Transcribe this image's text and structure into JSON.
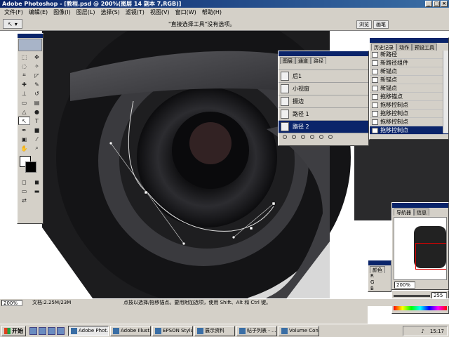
{
  "window": {
    "title": "Adobe Photoshop - [教程.psd @ 200%(图层 14 副本 7,RGB)]"
  },
  "menu": [
    "文件(F)",
    "编辑(E)",
    "图像(I)",
    "图层(L)",
    "选择(S)",
    "滤镜(T)",
    "视图(V)",
    "窗口(W)",
    "帮助(H)"
  ],
  "options_bar": {
    "message": "\"直接选择工具\"没有选项。",
    "tabs": [
      "浏览",
      "画笔"
    ]
  },
  "paths_panel": {
    "tabs": [
      "图层",
      "通道",
      "路径"
    ],
    "rows": [
      "",
      "后1",
      "小视窗",
      "摄边",
      "路径 1",
      "路径 2"
    ]
  },
  "history_panel": {
    "tabs": [
      "历史记录",
      "动作",
      "预设工具"
    ],
    "rows": [
      "新路径",
      "新路径组件",
      "新锚点",
      "新锚点",
      "新锚点",
      "拖移锚点",
      "拖移控制点",
      "拖移控制点",
      "拖移控制点",
      "拖移控制点"
    ]
  },
  "navigator_panel": {
    "tabs": [
      "导航器",
      "信息"
    ],
    "zoom": "200%"
  },
  "color_panel": {
    "tabs": [
      "颜色"
    ],
    "channels": [
      "R",
      "G",
      "B"
    ],
    "b_value": "255"
  },
  "status_bar": {
    "zoom": "200%",
    "doc_size": "文档:2.25M/23M",
    "hint": "点按以选择/拖移锚点。要用附加选项，使用 Shift、Alt 和 Ctrl 键。"
  },
  "taskbar": {
    "start": "开始",
    "tasks": [
      "Adobe Phot...",
      "Adobe Illust...",
      "EPSON Stylu...",
      "展示资料",
      "帖子列表 - ...",
      "Volume Control"
    ],
    "clock": "15:17"
  },
  "colors": {
    "titlebar": "#0a246a",
    "chrome": "#d4d0c8",
    "selected": "#0a246a"
  }
}
